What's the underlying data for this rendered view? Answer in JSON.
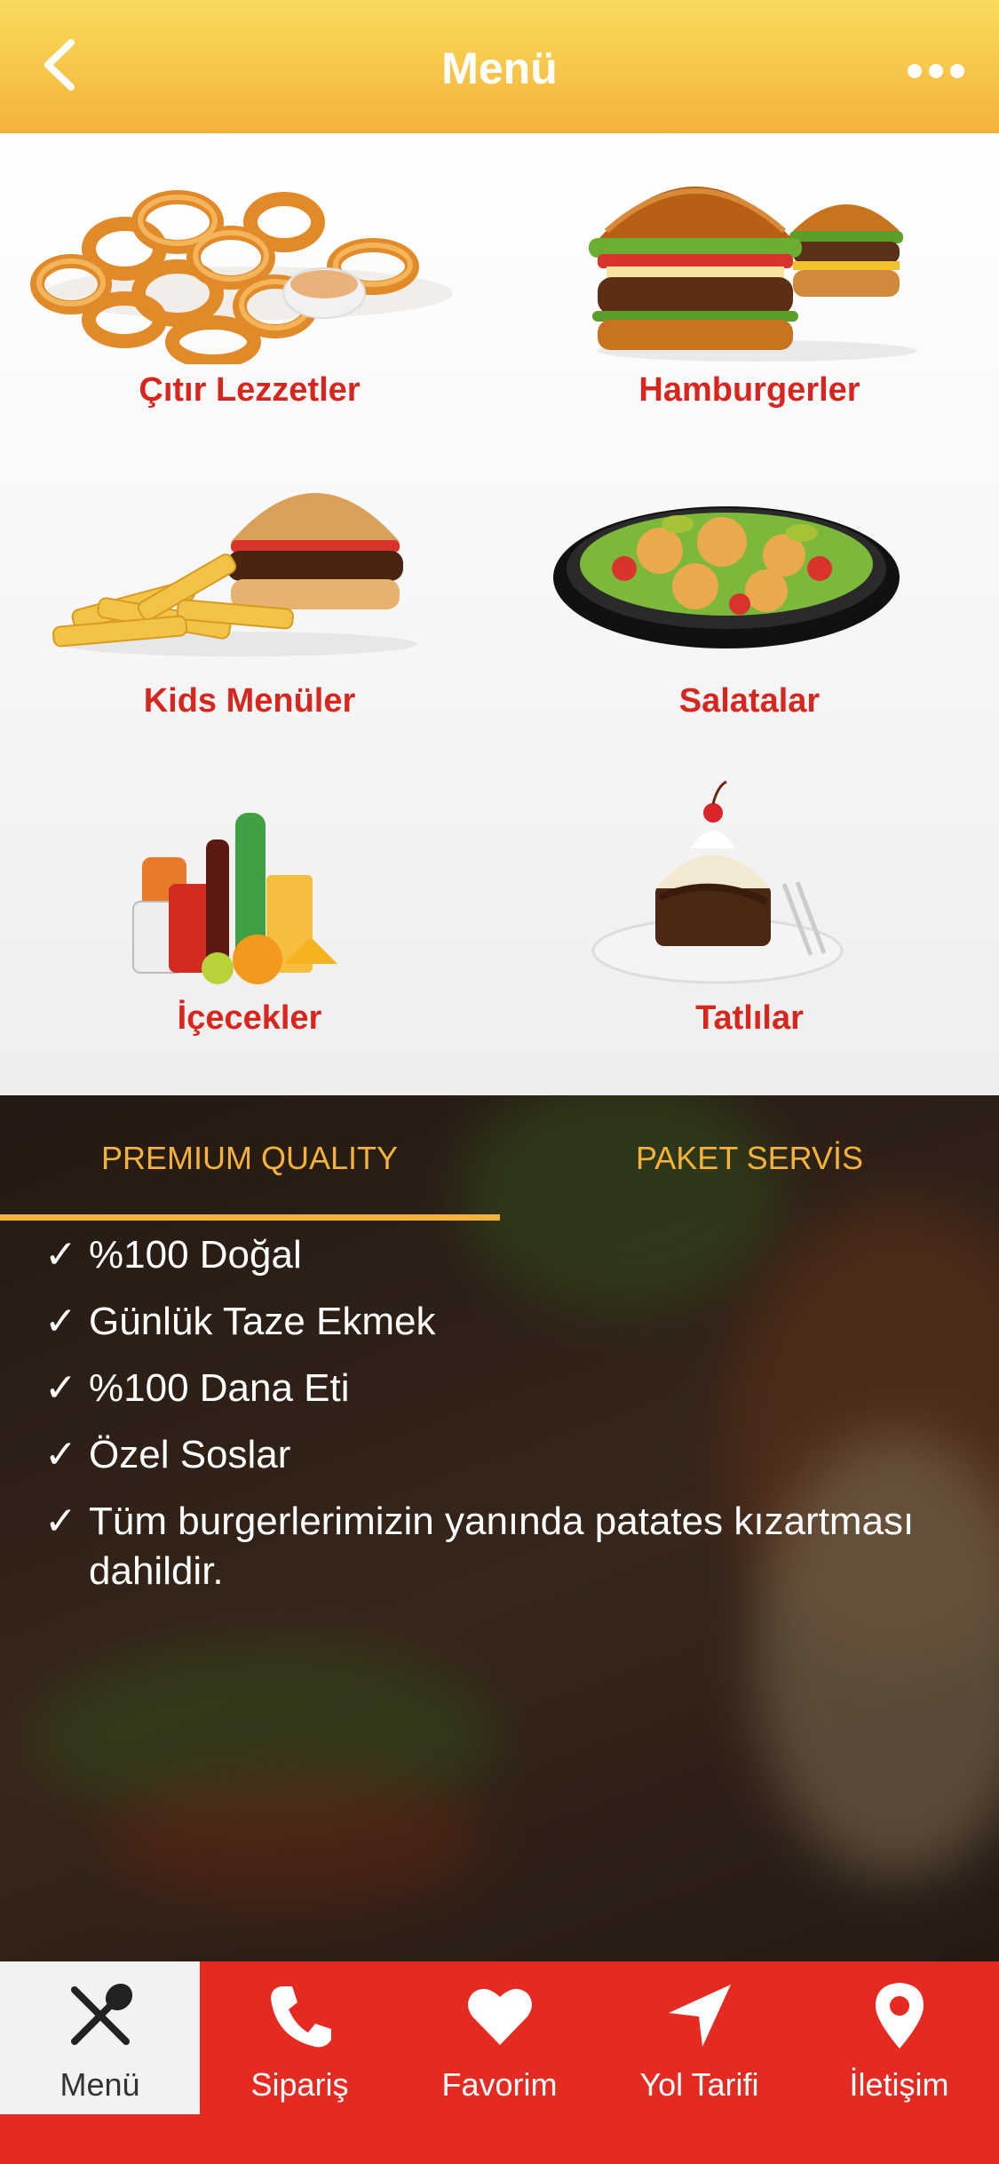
{
  "header": {
    "title": "Menü"
  },
  "categories": [
    {
      "label": "Çıtır Lezzetler",
      "icon": "onion-rings-icon"
    },
    {
      "label": "Hamburgerler",
      "icon": "burgers-icon"
    },
    {
      "label": "Kids Menüler",
      "icon": "kids-meal-icon"
    },
    {
      "label": "Salatalar",
      "icon": "salad-icon"
    },
    {
      "label": "İçecekler",
      "icon": "drinks-icon"
    },
    {
      "label": "Tatlılar",
      "icon": "dessert-icon"
    }
  ],
  "info_tabs": [
    {
      "label": "PREMIUM QUALITY",
      "active": true
    },
    {
      "label": "PAKET SERVİS",
      "active": false
    }
  ],
  "features": [
    "%100 Doğal",
    "Günlük Taze Ekmek",
    "%100 Dana Eti",
    "Özel Soslar",
    "Tüm burgerlerimizin yanında patates kızartması dahildir."
  ],
  "check_mark": "✓",
  "tabbar": [
    {
      "label": "Menü",
      "icon": "fork-spoon-icon",
      "active": true
    },
    {
      "label": "Sipariş",
      "icon": "phone-icon",
      "active": false
    },
    {
      "label": "Favorim",
      "icon": "heart-icon",
      "active": false
    },
    {
      "label": "Yol Tarifi",
      "icon": "navigation-arrow-icon",
      "active": false
    },
    {
      "label": "İletişim",
      "icon": "location-pin-icon",
      "active": false
    }
  ],
  "colors": {
    "header_gradient_top": "#F8DC5C",
    "header_gradient_bottom": "#F5B23A",
    "category_label": "#D7261E",
    "tab_accent": "#F5B23A",
    "tabbar_bg": "#E52A22",
    "tabbar_active_bg": "#F2F2F2"
  }
}
